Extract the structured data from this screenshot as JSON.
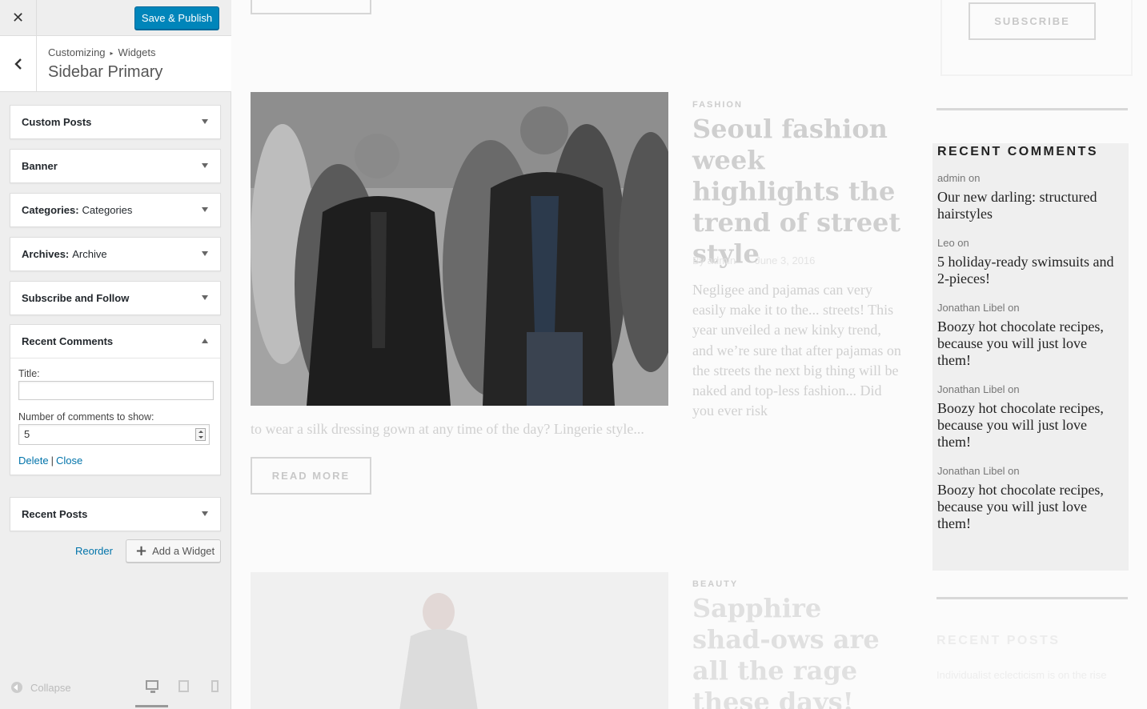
{
  "customizer": {
    "close_label": "✕",
    "save_label": "Save & Publish",
    "breadcrumb": [
      "Customizing",
      "Widgets"
    ],
    "breadcrumb_sep": "▸",
    "section_title": "Sidebar Primary",
    "widgets": [
      {
        "name": "Custom Posts",
        "subtitle": ""
      },
      {
        "name": "Banner",
        "subtitle": ""
      },
      {
        "name": "Categories:",
        "subtitle": "Categories"
      },
      {
        "name": "Archives:",
        "subtitle": "Archive"
      },
      {
        "name": "Subscribe and Follow",
        "subtitle": ""
      },
      {
        "name": "Recent Comments",
        "subtitle": ""
      },
      {
        "name": "Recent Posts",
        "subtitle": ""
      }
    ],
    "recent_comments_form": {
      "title_label": "Title:",
      "title_value": "",
      "count_label": "Number of comments to show:",
      "count_value": "5",
      "delete_label": "Delete",
      "separator": "|",
      "close_label": "Close"
    },
    "reorder_label": "Reorder",
    "add_widget_label": "Add a Widget",
    "collapse_label": "Collapse",
    "preview_device": "desktop"
  },
  "preview": {
    "read_more_label": "READ MORE",
    "subscribe_label": "SUBSCRIBE",
    "post1": {
      "category": "FASHION",
      "title": "Seoul fashion week highlights the trend of street style",
      "author": "By admin",
      "date": "June 3, 2016",
      "excerpt": "Negligee and pajamas can very easily make it to the... streets! This year unveiled a new kinky trend, and we’re sure that after pajamas on the streets the next big thing will be naked and top-less fashion... Did you ever risk",
      "excerpt_tail": "to wear a silk dressing gown at any time of the day? Lingerie style..."
    },
    "post2": {
      "category": "BEAUTY",
      "title": "Sapphire shad-ows are all the rage these days!"
    },
    "recent_comments": {
      "title": "RECENT COMMENTS",
      "items": [
        {
          "author": "admin on",
          "post": "Our new darling: structured hairstyles"
        },
        {
          "author": "Leo on",
          "post": "5 holiday-ready swimsuits and 2-pieces!"
        },
        {
          "author": "Jonathan Libel on",
          "post": "Boozy hot chocolate recipes, because you will just love them!"
        },
        {
          "author": "Jonathan Libel on",
          "post": "Boozy hot chocolate recipes, because you will just love them!"
        },
        {
          "author": "Jonathan Libel on",
          "post": "Boozy hot chocolate recipes, because you will just love them!"
        }
      ]
    },
    "recent_posts": {
      "title": "RECENT POSTS",
      "first_item": "Individualist eclecticism is on the rise"
    }
  },
  "colors": {
    "primary_button": "#0085ba",
    "link": "#0073aa",
    "sidebar_bg": "#eeeeee"
  }
}
